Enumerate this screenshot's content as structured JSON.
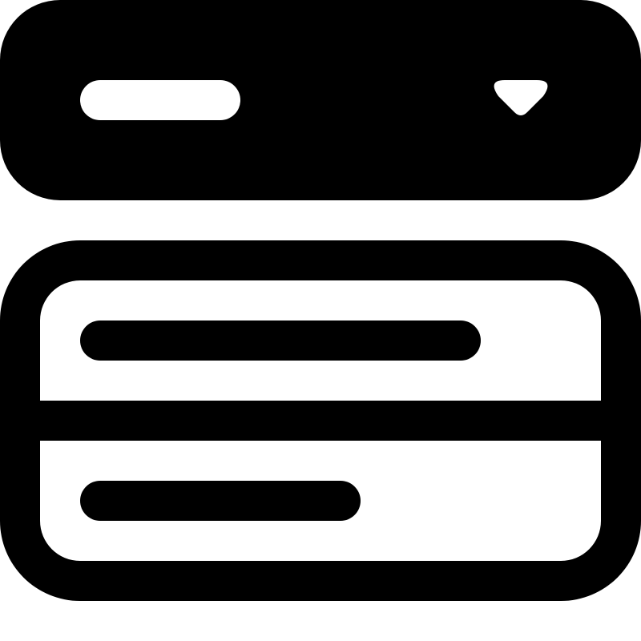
{
  "icon": {
    "name": "dropdown-select-list-icon",
    "colors": {
      "foreground": "#000000",
      "background": "#ffffff"
    },
    "select_box": {
      "indicator_icon": "chevron-down-icon",
      "state": "expanded"
    },
    "options": {
      "count": 2,
      "items": [
        "option-line",
        "option-line"
      ]
    }
  }
}
